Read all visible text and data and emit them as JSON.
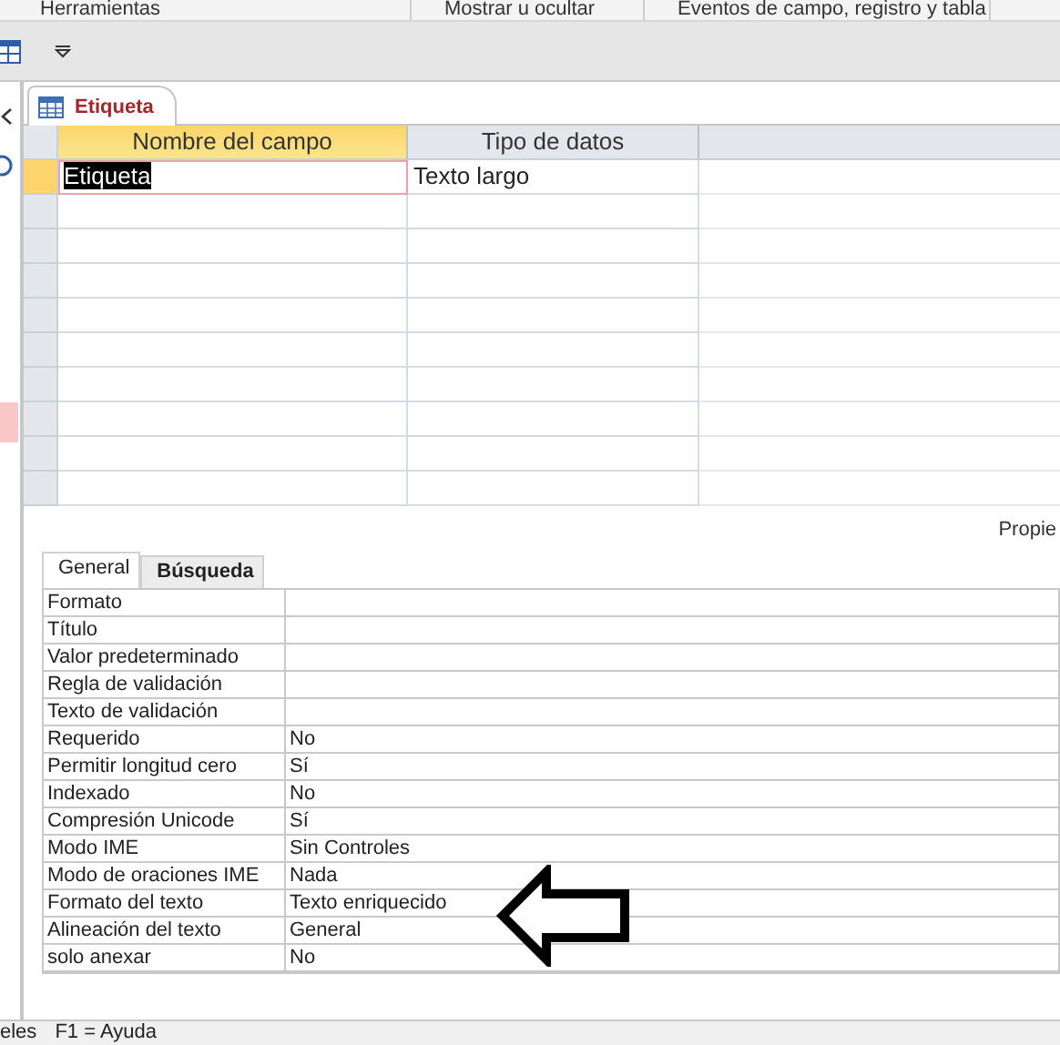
{
  "ribbon_groups": [
    "Herramientas",
    "Mostrar u ocultar",
    "Eventos de campo, registro y tabla"
  ],
  "document_tab": {
    "label": "Etiqueta",
    "selected": true
  },
  "table": {
    "columns": [
      "Nombre del campo",
      "Tipo de datos"
    ],
    "rows": [
      {
        "field_name": "Etiqueta",
        "data_type": "Texto largo",
        "selected": true
      }
    ]
  },
  "properties_label": "Propie",
  "property_tabs": [
    {
      "label": "General",
      "selected": true
    },
    {
      "label": "Búsqueda",
      "selected": false
    }
  ],
  "properties": [
    {
      "name": "Formato"
    },
    {
      "name": "Título"
    },
    {
      "name": "Valor predeterminado"
    },
    {
      "name": "Regla de validación"
    },
    {
      "name": "Texto de validación"
    },
    {
      "name": "Requerido",
      "value": "No"
    },
    {
      "name": "Permitir longitud cero",
      "value": "Sí"
    },
    {
      "name": "Indexado",
      "value": "No"
    },
    {
      "name": "Compresión Unicode",
      "value": "Sí"
    },
    {
      "name": "Modo IME",
      "value": "Sin Controles"
    },
    {
      "name": "Modo de oraciones IME",
      "value": "Nada"
    },
    {
      "name": "Formato del texto",
      "value": "Texto enriquecido"
    },
    {
      "name": "Alineación del texto",
      "value": "General"
    },
    {
      "name": "solo anexar",
      "value": "No"
    }
  ],
  "status_bar": [
    "eles",
    "F1 = Ayuda"
  ]
}
